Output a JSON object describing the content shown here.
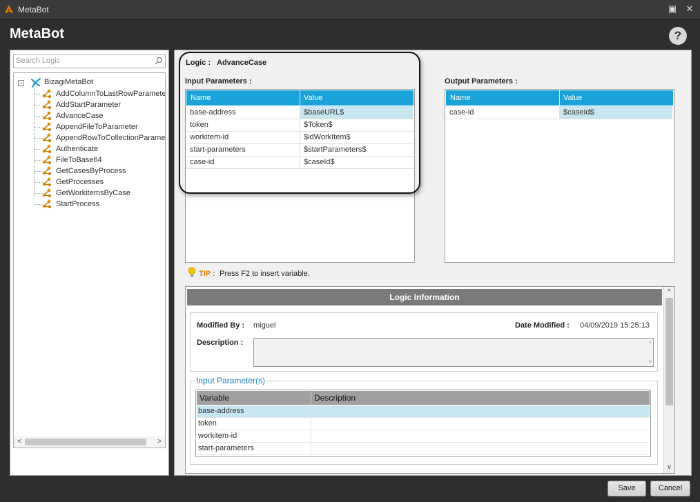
{
  "window": {
    "title": "MetaBot",
    "minimize_glyph": "▣",
    "close_glyph": "✕"
  },
  "header": {
    "title": "MetaBot",
    "help_glyph": "?"
  },
  "sidebar": {
    "search_placeholder": "Search Logic",
    "expander_glyph": "−",
    "root": {
      "label": "BizagiMetaBot",
      "icon": "bot-icon"
    },
    "items": [
      {
        "label": "AddColumnToLastRowParameter",
        "icon": "logic-icon"
      },
      {
        "label": "AddStartParameter",
        "icon": "logic-icon"
      },
      {
        "label": "AdvanceCase",
        "icon": "logic-icon"
      },
      {
        "label": "AppendFileToParameter",
        "icon": "logic-icon"
      },
      {
        "label": "AppendRowToCollectionParameter",
        "icon": "logic-icon"
      },
      {
        "label": "Authenticate",
        "icon": "logic-icon"
      },
      {
        "label": "FileToBase64",
        "icon": "logic-icon"
      },
      {
        "label": "GetCasesByProcess",
        "icon": "logic-icon"
      },
      {
        "label": "GetProcesses",
        "icon": "logic-icon"
      },
      {
        "label": "GetWorkitemsByCase",
        "icon": "logic-icon"
      },
      {
        "label": "StartProcess",
        "icon": "logic-icon"
      }
    ],
    "scroll_left": "<",
    "scroll_right": ">"
  },
  "logic": {
    "label": "Logic :",
    "value": "AdvanceCase"
  },
  "input_params": {
    "title": "Input Parameters :",
    "columns": [
      "Name",
      "Value"
    ],
    "rows": [
      {
        "name": "base-address",
        "value": "$baseURL$"
      },
      {
        "name": "token",
        "value": "$Token$"
      },
      {
        "name": "workitem-id",
        "value": "$idWorkItem$"
      },
      {
        "name": "start-parameters",
        "value": "$startParameters$"
      },
      {
        "name": "case-id",
        "value": "$caseId$"
      }
    ]
  },
  "output_params": {
    "title": "Output Parameters :",
    "columns": [
      "Name",
      "Value"
    ],
    "rows": [
      {
        "name": "case-id",
        "value": "$caseId$"
      }
    ]
  },
  "tip": {
    "label": "TIP :",
    "text": "Press F2 to insert variable."
  },
  "info": {
    "header": "Logic Information",
    "modified_by_label": "Modified By :",
    "modified_by": "miguel",
    "date_modified_label": "Date Modified :",
    "date_modified": "04/09/2019 15:25:13",
    "description_label": "Description :",
    "description": "",
    "input_params_legend": "Input Parameter(s)",
    "columns": [
      "Variable",
      "Description"
    ],
    "rows": [
      {
        "variable": "base-address",
        "description": ""
      },
      {
        "variable": "token",
        "description": ""
      },
      {
        "variable": "workitem-id",
        "description": ""
      },
      {
        "variable": "start-parameters",
        "description": ""
      }
    ],
    "scroll_up": "^",
    "scroll_down": "v"
  },
  "footer": {
    "save_label": "Save",
    "cancel_label": "Cancel"
  },
  "colors": {
    "grid_header": "#1aa3d9",
    "selected_row": "#c8e6f0",
    "tip": "#e07b00",
    "legend": "#1a7fc0"
  }
}
